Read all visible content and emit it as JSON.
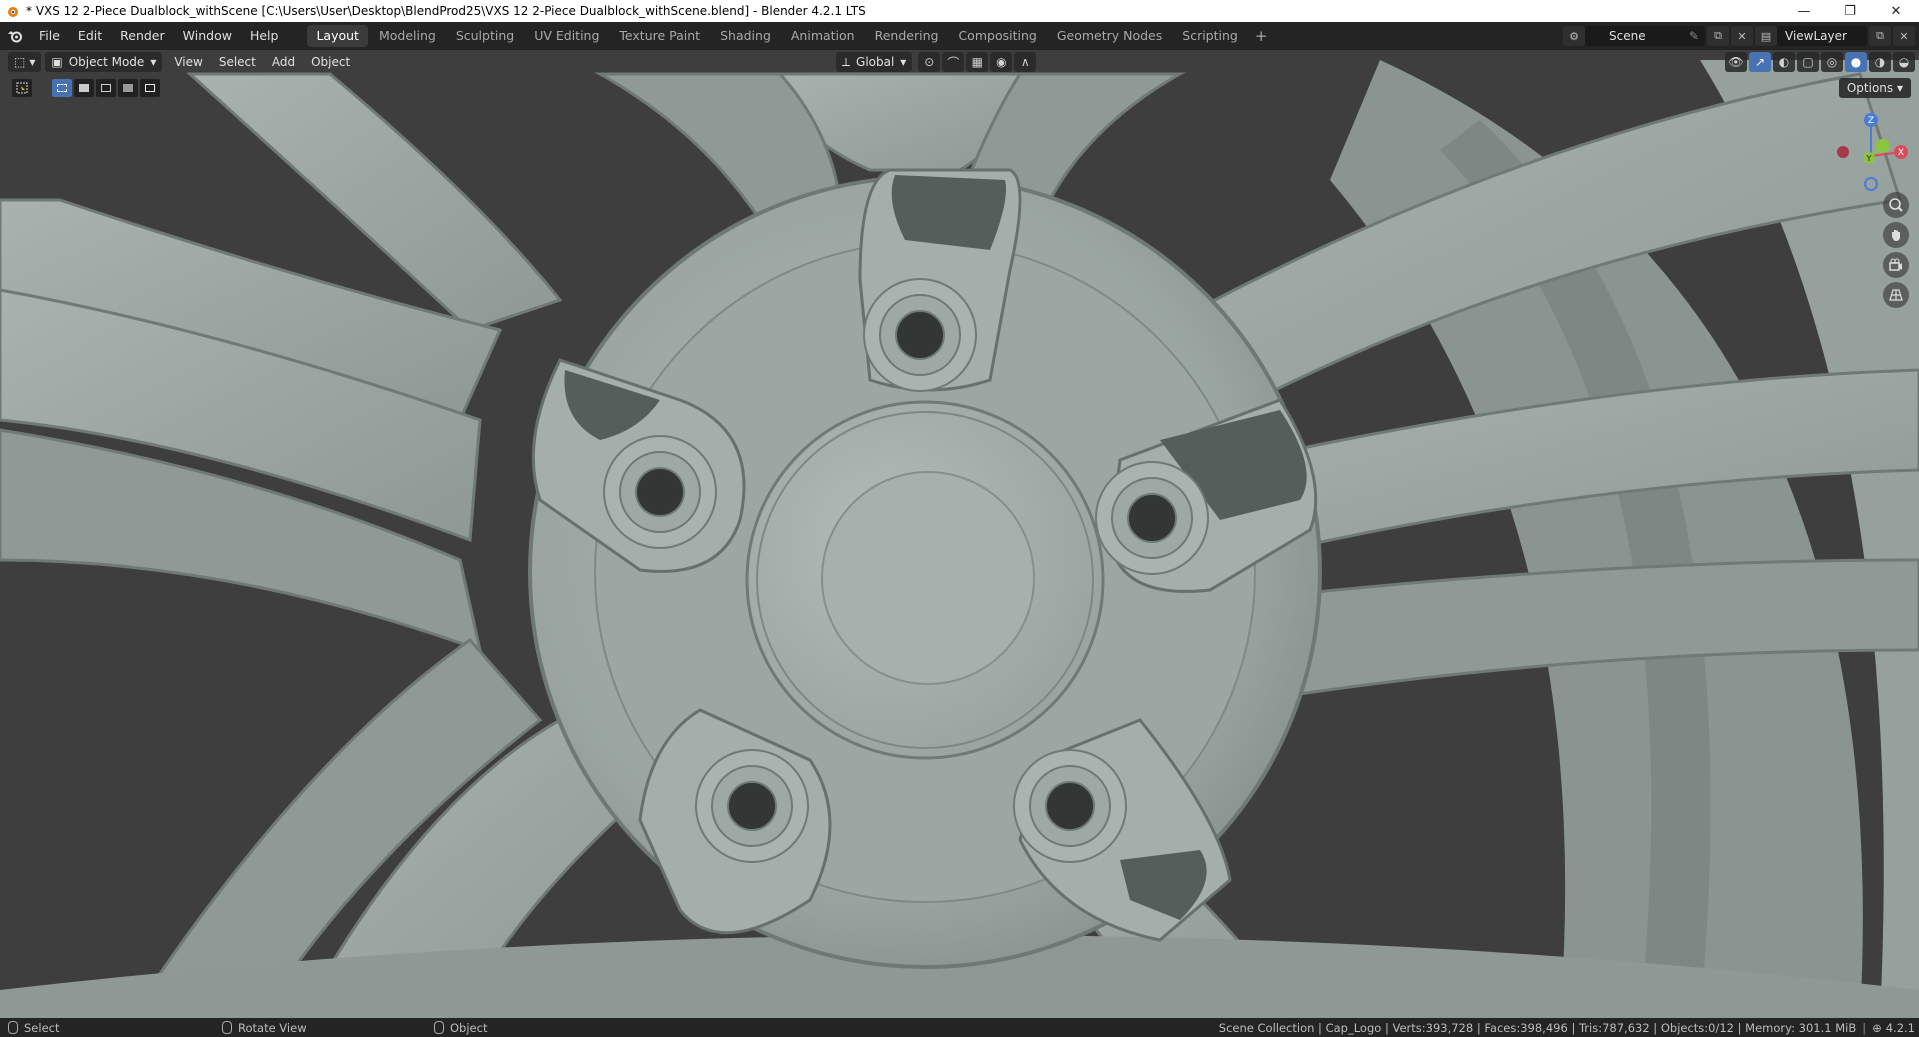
{
  "window": {
    "title": "* VXS 12 2-Piece Dualblock_withScene [C:\\Users\\User\\Desktop\\BlendProd25\\VXS 12 2-Piece Dualblock_withScene.blend] - Blender 4.2.1 LTS",
    "minimize": "—",
    "maximize": "❐",
    "close": "✕"
  },
  "menu": [
    "File",
    "Edit",
    "Render",
    "Window",
    "Help"
  ],
  "workspaces": [
    "Layout",
    "Modeling",
    "Sculpting",
    "UV Editing",
    "Texture Paint",
    "Shading",
    "Animation",
    "Rendering",
    "Compositing",
    "Geometry Nodes",
    "Scripting"
  ],
  "active_workspace": "Layout",
  "scene": "Scene",
  "view_layer": "ViewLayer",
  "viewport_header": {
    "mode": "Object Mode",
    "menus": [
      "View",
      "Select",
      "Add",
      "Object"
    ],
    "transform_orientation": "Global",
    "options": "Options"
  },
  "gizmo": {
    "x": "X",
    "y": "Y",
    "z": "Z"
  },
  "status": {
    "select": "Select",
    "rotate": "Rotate View",
    "object": "Object",
    "stats": "Scene Collection | Cap_Logo | Verts:393,728 | Faces:398,496 | Tris:787,632 | Objects:0/12 | Memory: 301.1 MiB",
    "version": "4.2.1"
  },
  "colors": {
    "accent": "#4772b3",
    "viewport_bg": "#3d3d3d",
    "wheel_surface": "#9aa5a2",
    "topbar": "#242424"
  }
}
